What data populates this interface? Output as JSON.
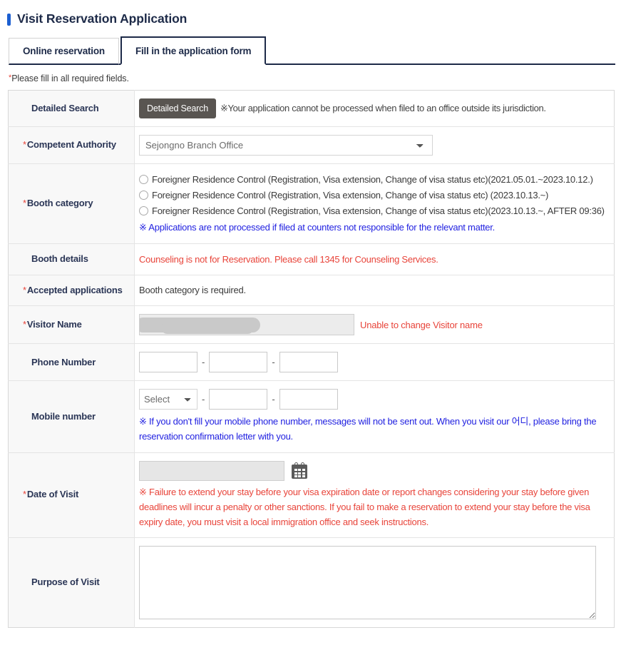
{
  "header": {
    "title": "Visit Reservation Application"
  },
  "tabs": [
    {
      "label": "Online reservation",
      "active": false
    },
    {
      "label": "Fill in the application form",
      "active": true
    }
  ],
  "required_note": "Please fill in all required fields.",
  "form": {
    "detailed_search": {
      "label": "Detailed Search",
      "button_label": "Detailed Search",
      "note": "※Your application cannot be processed when filed to an office outside its jurisdiction."
    },
    "competent_authority": {
      "label": "Competent Authority",
      "required": true,
      "selected": "Sejongno Branch Office"
    },
    "booth_category": {
      "label": "Booth category",
      "required": true,
      "options": [
        "Foreigner Residence Control (Registration, Visa extension, Change of visa status etc)(2021.05.01.~2023.10.12.)",
        "Foreigner Residence Control (Registration, Visa extension, Change of visa status etc) (2023.10.13.~)",
        "Foreigner Residence Control (Registration, Visa extension, Change of visa status etc)(2023.10.13.~, AFTER 09:36)"
      ],
      "note": "※ Applications are not processed if filed at counters not responsible for the relevant matter."
    },
    "booth_details": {
      "label": "Booth details",
      "note": "Counseling is not for Reservation. Please call 1345 for Counseling Services."
    },
    "accepted_applications": {
      "label": "Accepted applications",
      "required": true,
      "value": "Booth category is required."
    },
    "visitor_name": {
      "label": "Visitor Name",
      "required": true,
      "value": "",
      "note": "Unable to change Visitor name"
    },
    "phone_number": {
      "label": "Phone Number",
      "part1": "",
      "part2": "",
      "part3": "",
      "separator": "-"
    },
    "mobile_number": {
      "label": "Mobile number",
      "prefix_selected": "Select",
      "part2": "",
      "part3": "",
      "separator": "-",
      "note": "※ If you don't fill your mobile phone number, messages will not be sent out. When you visit our 어디, please bring the reservation confirmation letter with you."
    },
    "date_of_visit": {
      "label": "Date of Visit",
      "required": true,
      "value": "",
      "calendar_icon": "calendar-icon",
      "note": "※ Failure to extend your stay before your visa expiration date or report changes considering your stay before given deadlines will incur a penalty or other sanctions. If you fail to make a reservation to extend your stay before the visa expiry date, you must visit a local immigration office and seek instructions."
    },
    "purpose_of_visit": {
      "label": "Purpose of Visit",
      "value": "",
      "placeholder": ""
    }
  },
  "colors": {
    "accent_navy": "#1d2a48",
    "marker_blue": "#1c5fd1",
    "required_red": "#e8443a",
    "note_blue": "#1f1fe0",
    "button_gray": "#595551"
  }
}
